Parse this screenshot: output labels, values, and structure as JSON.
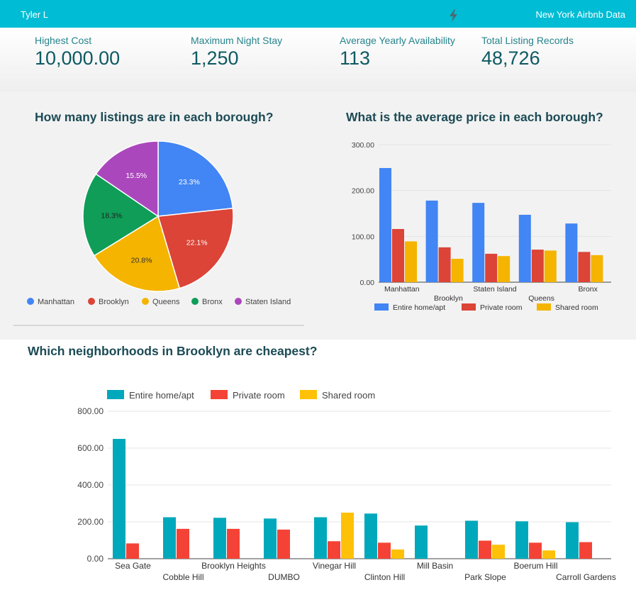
{
  "header": {
    "user": "Tyler L",
    "title": "New York Airbnb Data",
    "icon": "bolt-icon"
  },
  "kpis": [
    {
      "label": "Highest Cost",
      "value": "10,000.00"
    },
    {
      "label": "Maximum Night Stay",
      "value": "1,250"
    },
    {
      "label": "Average Yearly Availability",
      "value": "113"
    },
    {
      "label": "Total Listing Records",
      "value": "48,726"
    }
  ],
  "colors": {
    "primary": "#00bcd4",
    "teal": "#00a8bb",
    "blue": "#4285f4",
    "red": "#db4437",
    "yellow": "#f4b400",
    "green": "#0f9d58",
    "purple": "#ab47bc",
    "redB": "#f44336",
    "yellowB": "#ffc107"
  },
  "chart_data": [
    {
      "type": "pie",
      "title": "How many listings are in each borough?",
      "labels": [
        "Manhattan",
        "Brooklyn",
        "Queens",
        "Bronx",
        "Staten Island"
      ],
      "values": [
        23.3,
        22.1,
        20.8,
        18.3,
        15.5
      ],
      "value_labels": [
        "23.3%",
        "22.1%",
        "20.8%",
        "18.3%",
        "15.5%"
      ],
      "colors": [
        "#4285f4",
        "#db4437",
        "#f4b400",
        "#0f9d58",
        "#ab47bc"
      ],
      "legend": "bottom"
    },
    {
      "type": "bar",
      "title": "What is the average price in each borough?",
      "categories": [
        "Manhattan",
        "Brooklyn",
        "Staten Island",
        "Queens",
        "Bronx"
      ],
      "series": [
        {
          "name": "Entire home/apt",
          "values": [
            249,
            178,
            173,
            147,
            128
          ]
        },
        {
          "name": "Private room",
          "values": [
            116,
            76,
            62,
            71,
            66
          ]
        },
        {
          "name": "Shared room",
          "values": [
            89,
            51,
            57,
            69,
            59
          ]
        }
      ],
      "colors": [
        "#4285f4",
        "#db4437",
        "#f4b400"
      ],
      "ylim": [
        0,
        300
      ],
      "yticks": [
        "0.00",
        "100.00",
        "200.00",
        "300.00"
      ],
      "legend": "bottom"
    },
    {
      "type": "bar",
      "title": "Which neighborhoods in Brooklyn are cheapest?",
      "categories": [
        "Sea Gate",
        "Cobble Hill",
        "Brooklyn Heights",
        "DUMBO",
        "Vinegar Hill",
        "Clinton Hill",
        "Mill Basin",
        "Park Slope",
        "Boerum Hill",
        "Carroll Gardens"
      ],
      "series": [
        {
          "name": "Entire home/apt",
          "values": [
            650,
            225,
            222,
            218,
            225,
            245,
            180,
            206,
            203,
            198
          ]
        },
        {
          "name": "Private room",
          "values": [
            83,
            162,
            162,
            158,
            95,
            87,
            null,
            98,
            87,
            90
          ]
        },
        {
          "name": "Shared room",
          "values": [
            null,
            null,
            null,
            null,
            250,
            50,
            null,
            76,
            45,
            null
          ]
        }
      ],
      "colors": [
        "#00a8bb",
        "#f44336",
        "#ffc107"
      ],
      "ylim": [
        0,
        800
      ],
      "yticks": [
        "0.00",
        "200.00",
        "400.00",
        "600.00",
        "800.00"
      ],
      "legend": "top"
    }
  ]
}
